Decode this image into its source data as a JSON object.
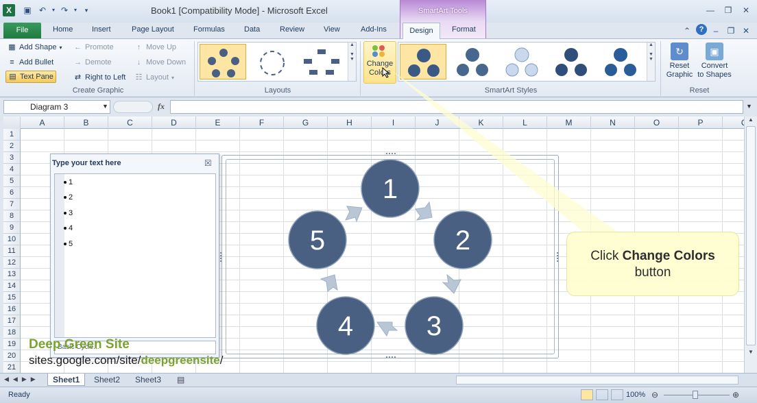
{
  "window": {
    "title": "Book1  [Compatibility Mode]  -  Microsoft Excel",
    "contextual_title": "SmartArt Tools"
  },
  "tabs": {
    "file": "File",
    "home": "Home",
    "insert": "Insert",
    "page_layout": "Page Layout",
    "formulas": "Formulas",
    "data": "Data",
    "review": "Review",
    "view": "View",
    "addins": "Add-Ins",
    "design": "Design",
    "format": "Format"
  },
  "create_graphic": {
    "add_shape": "Add Shape",
    "add_bullet": "Add Bullet",
    "text_pane": "Text Pane",
    "promote": "Promote",
    "demote": "Demote",
    "right_to_left": "Right to Left",
    "move_up": "Move Up",
    "move_down": "Move Down",
    "layout": "Layout",
    "label": "Create Graphic"
  },
  "layouts": {
    "label": "Layouts"
  },
  "smartart_styles": {
    "change_colors": "Change Colors",
    "change_colors_line1": "Change",
    "change_colors_line2": "Colors",
    "label": "SmartArt Styles"
  },
  "reset": {
    "reset_graphic_1": "Reset",
    "reset_graphic_2": "Graphic",
    "convert_1": "Convert",
    "convert_2": "to Shapes",
    "label": "Reset"
  },
  "formula_bar": {
    "name_box": "Diagram 3",
    "fx": "fx"
  },
  "columns": [
    "A",
    "B",
    "C",
    "D",
    "E",
    "F",
    "G",
    "H",
    "I",
    "J",
    "K",
    "L",
    "M",
    "N",
    "O",
    "P",
    "Q"
  ],
  "rows": [
    "1",
    "2",
    "3",
    "4",
    "5",
    "6",
    "7",
    "8",
    "9",
    "10",
    "11",
    "12",
    "13",
    "14",
    "15",
    "16",
    "17",
    "18",
    "19",
    "20",
    "21"
  ],
  "text_pane": {
    "title": "Type your text here",
    "items": [
      "1",
      "2",
      "3",
      "4",
      "5"
    ],
    "footer": "Basic Cycle..."
  },
  "diagram": {
    "nodes": [
      "1",
      "2",
      "3",
      "4",
      "5"
    ],
    "node_color": "#4a6083",
    "arrow_color": "#b9c6d6"
  },
  "callout": {
    "line1_prefix": "Click ",
    "line1_bold": "Change Colors",
    "line2": "button"
  },
  "watermark": {
    "title": "Deep Green Site",
    "url_prefix": "sites.google.com/site/",
    "url_highlight": "deepgreensite",
    "url_suffix": "/"
  },
  "sheets": [
    "Sheet1",
    "Sheet2",
    "Sheet3"
  ],
  "status": {
    "ready": "Ready",
    "zoom": "100%"
  },
  "colors": {
    "excel_green": "#1e7145",
    "smartart_purple": "#b989d6",
    "highlight": "#fde6a3"
  }
}
